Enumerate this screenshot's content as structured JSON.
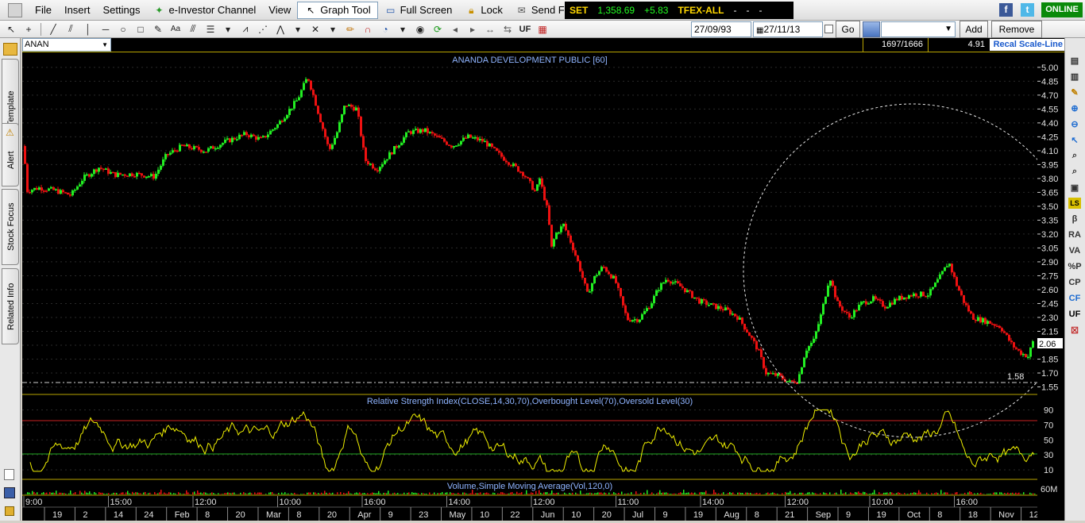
{
  "menu": {
    "file": "File",
    "insert": "Insert",
    "settings": "Settings",
    "channel": "e-Investor Channel",
    "view": "View",
    "graph_tool": "Graph Tool",
    "full_screen": "Full Screen",
    "lock": "Lock",
    "feedback": "Send Feedback",
    "online": "ONLINE"
  },
  "ticker": {
    "index_name": "SET",
    "index_value": "1,358.69",
    "index_change": "+5.83",
    "tfex": "TFEX-ALL",
    "d1": "-",
    "d2": "-",
    "d3": "-"
  },
  "toolbar": {
    "uf_label": "UF",
    "date_from": "27/09/93",
    "date_to": "27/11/13",
    "go_label": "Go",
    "add_label": "Add",
    "remove_label": "Remove"
  },
  "symbol": {
    "code": "ANAN",
    "ratio": "1697/1666",
    "value": "4.91",
    "scale_mode": "Recal Scale-Line"
  },
  "side_tabs": [
    "Template",
    "Alert",
    "Stock Focus",
    "Related Info"
  ],
  "right_icons": [
    "LS",
    "β",
    "RA",
    "VA",
    "%P",
    "CP",
    "CF",
    "UF"
  ],
  "colors": {
    "up": "#22ee22",
    "down": "#ee1111",
    "rsi": "#f0f000",
    "title_text": "#8fb4ff",
    "panel_border": "#b8a400",
    "ticker_value": "#ffffff",
    "ticker_change": "#22ff22",
    "online_bg": "#0a8a0a"
  },
  "chart_data": [
    {
      "type": "candlestick",
      "title": "ANANDA DEVELOPMENT PUBLIC [60]",
      "ylim": [
        1.52,
        5.05
      ],
      "y_ticks": [
        "5.00",
        "4.85",
        "4.70",
        "4.55",
        "4.40",
        "4.25",
        "4.10",
        "3.95",
        "3.80",
        "3.65",
        "3.50",
        "3.35",
        "3.20",
        "3.05",
        "2.90",
        "2.75",
        "2.60",
        "2.45",
        "2.30",
        "2.15",
        "2.00",
        "1.85",
        "1.70",
        "1.55"
      ],
      "last_price": "2.06",
      "annotation": "1.58",
      "price_path": [
        [
          0,
          4.15
        ],
        [
          5,
          3.67
        ],
        [
          20,
          3.7
        ],
        [
          40,
          3.67
        ],
        [
          60,
          3.62
        ],
        [
          75,
          3.8
        ],
        [
          95,
          3.92
        ],
        [
          115,
          3.84
        ],
        [
          140,
          3.85
        ],
        [
          165,
          3.82
        ],
        [
          180,
          4.05
        ],
        [
          200,
          4.15
        ],
        [
          230,
          4.1
        ],
        [
          255,
          4.2
        ],
        [
          280,
          4.28
        ],
        [
          300,
          4.22
        ],
        [
          320,
          4.38
        ],
        [
          345,
          4.65
        ],
        [
          358,
          4.9
        ],
        [
          365,
          4.7
        ],
        [
          375,
          4.4
        ],
        [
          385,
          4.1
        ],
        [
          395,
          4.3
        ],
        [
          405,
          4.6
        ],
        [
          420,
          4.55
        ],
        [
          430,
          4.0
        ],
        [
          445,
          3.9
        ],
        [
          460,
          4.05
        ],
        [
          485,
          4.3
        ],
        [
          505,
          4.32
        ],
        [
          520,
          4.25
        ],
        [
          540,
          4.15
        ],
        [
          560,
          4.25
        ],
        [
          580,
          4.2
        ],
        [
          600,
          4.05
        ],
        [
          615,
          3.95
        ],
        [
          630,
          3.85
        ],
        [
          645,
          3.65
        ],
        [
          650,
          3.8
        ],
        [
          660,
          3.45
        ],
        [
          665,
          3.05
        ],
        [
          670,
          3.2
        ],
        [
          680,
          3.3
        ],
        [
          690,
          3.1
        ],
        [
          700,
          2.85
        ],
        [
          710,
          2.55
        ],
        [
          720,
          2.75
        ],
        [
          730,
          2.85
        ],
        [
          745,
          2.7
        ],
        [
          760,
          2.28
        ],
        [
          775,
          2.28
        ],
        [
          790,
          2.45
        ],
        [
          800,
          2.62
        ],
        [
          810,
          2.72
        ],
        [
          830,
          2.62
        ],
        [
          850,
          2.48
        ],
        [
          870,
          2.42
        ],
        [
          885,
          2.38
        ],
        [
          900,
          2.3
        ],
        [
          915,
          2.1
        ],
        [
          925,
          1.95
        ],
        [
          935,
          1.7
        ],
        [
          950,
          1.67
        ],
        [
          965,
          1.6
        ],
        [
          975,
          1.62
        ],
        [
          985,
          1.95
        ],
        [
          995,
          2.05
        ],
        [
          1005,
          2.35
        ],
        [
          1015,
          2.75
        ],
        [
          1025,
          2.45
        ],
        [
          1040,
          2.3
        ],
        [
          1055,
          2.45
        ],
        [
          1070,
          2.5
        ],
        [
          1085,
          2.42
        ],
        [
          1100,
          2.5
        ],
        [
          1120,
          2.55
        ],
        [
          1140,
          2.55
        ],
        [
          1155,
          2.75
        ],
        [
          1165,
          2.9
        ],
        [
          1175,
          2.65
        ],
        [
          1185,
          2.45
        ],
        [
          1195,
          2.3
        ],
        [
          1215,
          2.25
        ],
        [
          1230,
          2.2
        ],
        [
          1245,
          2.0
        ],
        [
          1255,
          1.92
        ],
        [
          1265,
          1.88
        ],
        [
          1272,
          2.06
        ]
      ],
      "ellipse": {
        "cx": 1145,
        "cy": 2.15,
        "note": "dashed highlight"
      }
    },
    {
      "type": "line",
      "title": "Relative Strength Index(CLOSE,14,30,70),Overbought Level(70),Oversold Level(30)",
      "ylim": [
        0,
        100
      ],
      "y_ticks": [
        "90",
        "70",
        "50",
        "30",
        "10"
      ],
      "levels": [
        70,
        30
      ]
    },
    {
      "type": "bar",
      "title": "Volume,Simple Moving Average(Vol,120,0)",
      "y_ticks": [
        "60M"
      ]
    }
  ],
  "x_axis": {
    "times": [
      "9:00",
      "15:00",
      "12:00",
      "10:00",
      "16:00",
      "14:00",
      "12:00",
      "11:00",
      "14:00",
      "12:00",
      "10:00",
      "16:00"
    ],
    "dates": [
      "19",
      "2",
      "14",
      "24",
      "Feb",
      "8",
      "20",
      "Mar",
      "8",
      "20",
      "Apr",
      "9",
      "23",
      "May",
      "10",
      "22",
      "Jun",
      "10",
      "20",
      "Jul",
      "9",
      "19",
      "Aug",
      "8",
      "21",
      "Sep",
      "9",
      "19",
      "Oct",
      "8",
      "18",
      "Nov",
      "12"
    ]
  }
}
